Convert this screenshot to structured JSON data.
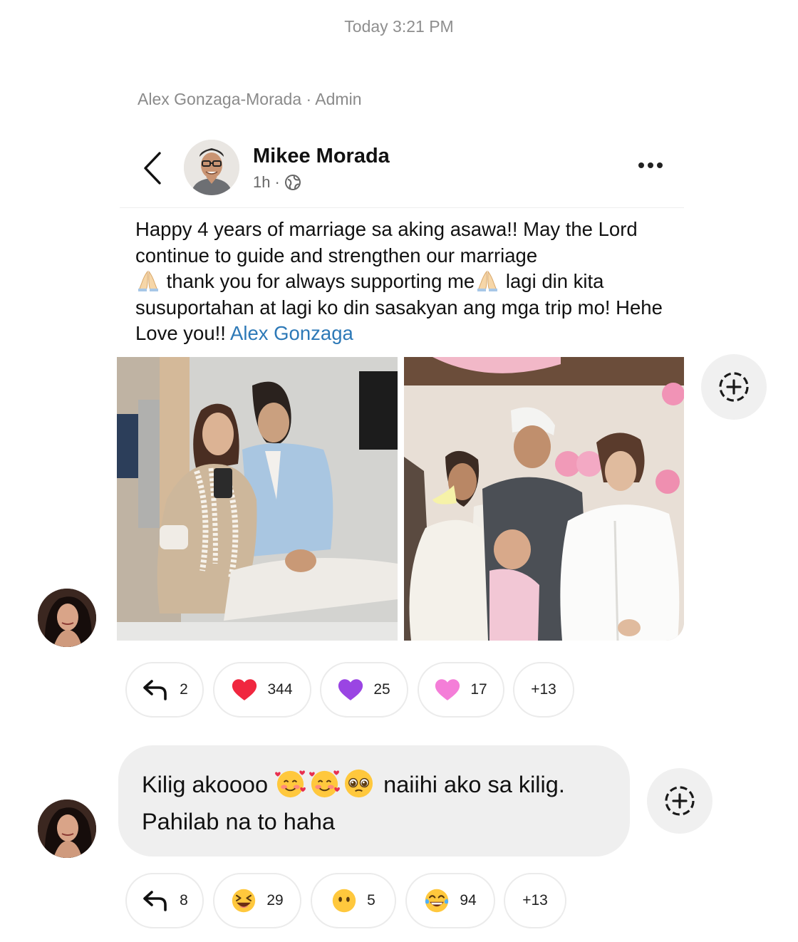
{
  "timestamp": "Today 3:21 PM",
  "shared_post": {
    "sender_line": "Alex Gonzaga-Morada · Admin",
    "author": "Mikee Morada",
    "time_ago": "1h",
    "meta_separator": "·",
    "text_1": "Happy 4 years of marriage sa aking asawa!! May the Lord continue to guide and strengthen our marriage",
    "text_2": "thank you for always supporting me",
    "text_3": "lagi din kita susuportahan at lagi ko din sasakyan ang mga trip mo! Hehe Love you!!",
    "mention": "Alex Gonzaga",
    "text_emoji": "folded-hands-icon",
    "reactions": {
      "reply_count": "2",
      "items": [
        {
          "icon": "red-heart-icon",
          "count": "344",
          "color": "#f0273f"
        },
        {
          "icon": "purple-heart-icon",
          "count": "25",
          "color": "#9a45e3"
        },
        {
          "icon": "pink-heart-icon",
          "count": "17",
          "color": "#f47ed8"
        }
      ],
      "more": "+13"
    }
  },
  "comment": {
    "line_1_start": "Kilig akoooo",
    "line_1_end": "naiihi ako sa kilig.",
    "line_2": "Pahilab na to haha",
    "emojis": [
      "smiling-face-with-hearts-icon",
      "smiling-face-with-hearts-icon",
      "pleading-face-icon"
    ],
    "reactions": {
      "reply_count": "8",
      "items": [
        {
          "icon": "squinting-laugh-icon",
          "count": "29"
        },
        {
          "icon": "no-mouth-face-icon",
          "count": "5"
        },
        {
          "icon": "tears-of-joy-icon",
          "count": "94"
        }
      ],
      "more": "+13"
    }
  },
  "colors": {
    "background": "#ffffff",
    "bubble": "#efefef",
    "mention": "#2d79b7",
    "muted_text": "#8e8e8e"
  }
}
